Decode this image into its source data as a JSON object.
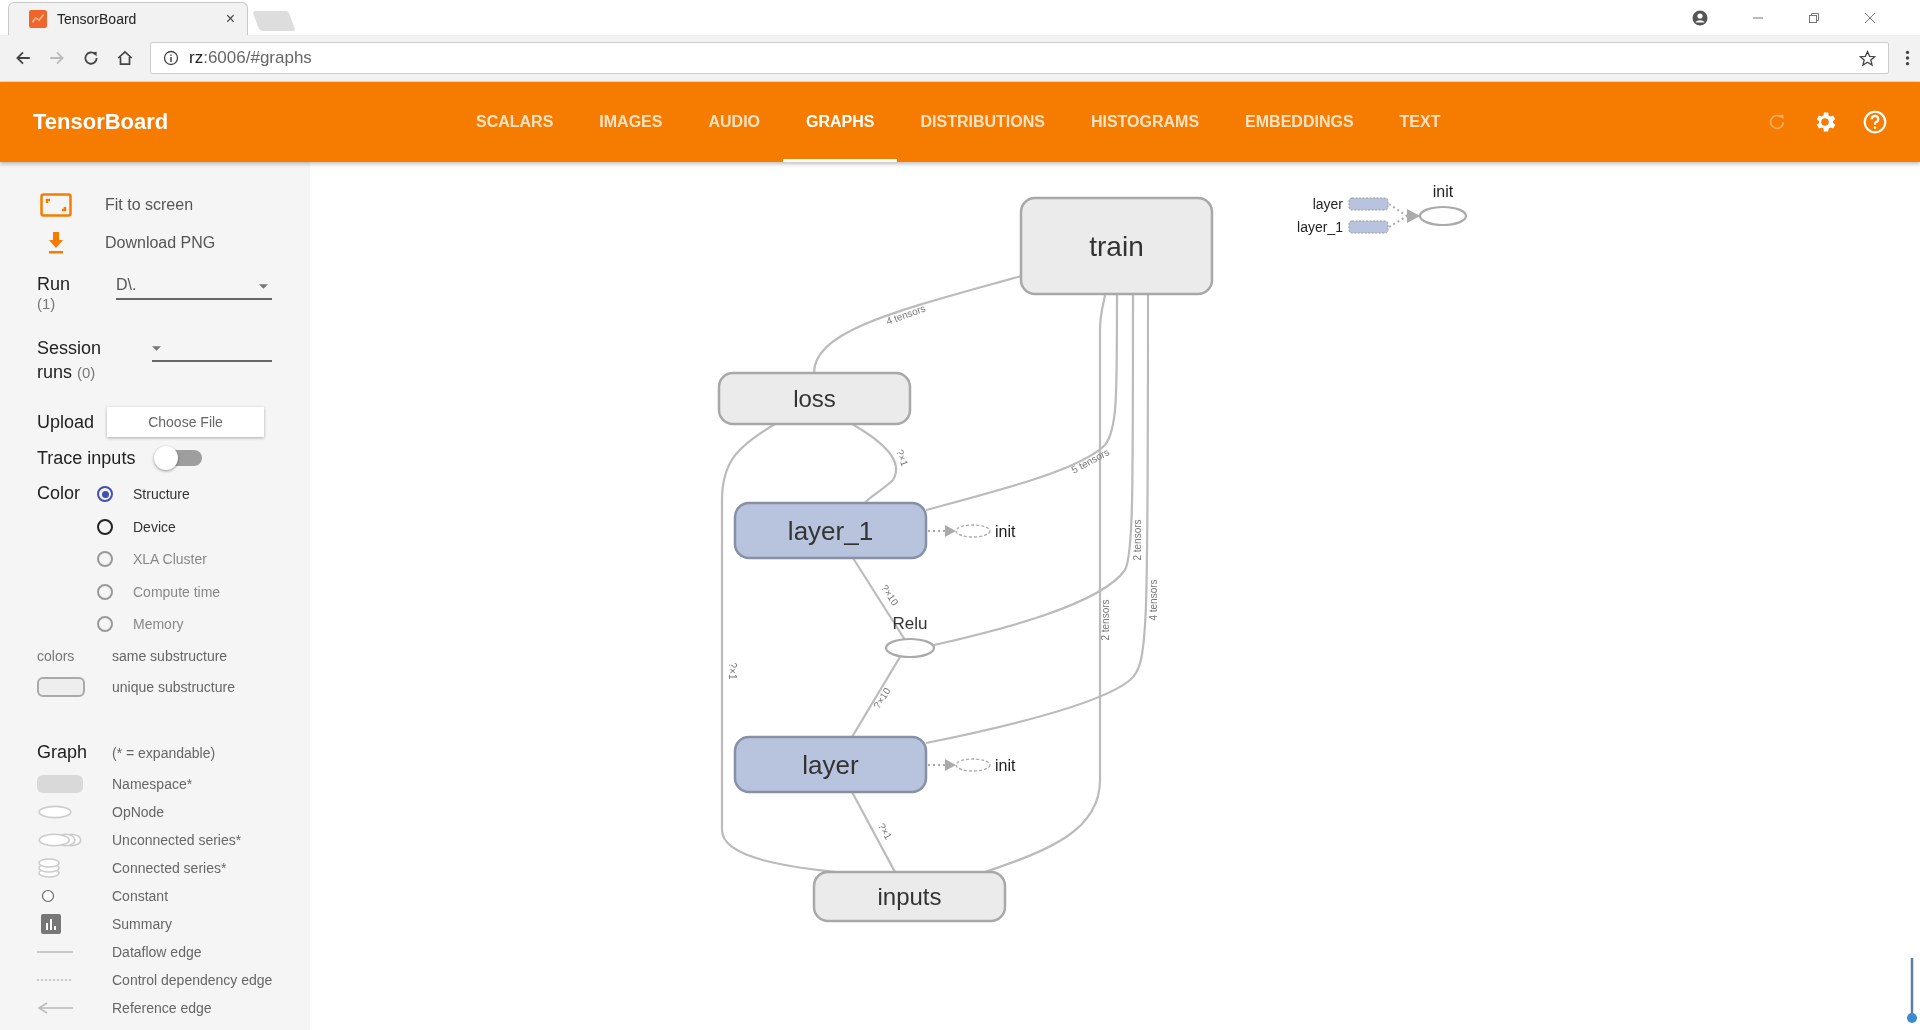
{
  "browser": {
    "tab_title": "TensorBoard",
    "tab_close": "×",
    "url_host": "rz",
    "url_rest": ":6006/#graphs"
  },
  "app": {
    "title": "TensorBoard"
  },
  "nav_tabs": [
    {
      "label": "SCALARS",
      "selected": false
    },
    {
      "label": "IMAGES",
      "selected": false
    },
    {
      "label": "AUDIO",
      "selected": false
    },
    {
      "label": "GRAPHS",
      "selected": true
    },
    {
      "label": "DISTRIBUTIONS",
      "selected": false
    },
    {
      "label": "HISTOGRAMS",
      "selected": false
    },
    {
      "label": "EMBEDDINGS",
      "selected": false
    },
    {
      "label": "TEXT",
      "selected": false
    }
  ],
  "sidebar": {
    "actions": [
      {
        "kind": "fit",
        "label": "Fit to screen"
      },
      {
        "kind": "download",
        "label": "Download PNG"
      }
    ],
    "run": {
      "label": "Run",
      "count": "(1)",
      "value": "D\\."
    },
    "session_runs": {
      "label": "Session runs",
      "count": "(0)"
    },
    "upload": {
      "label": "Upload",
      "button": "Choose File"
    },
    "trace_inputs": {
      "label": "Trace inputs",
      "on": false
    },
    "color": {
      "label": "Color",
      "options": [
        {
          "label": "Structure",
          "selected": true,
          "disabled": false
        },
        {
          "label": "Device",
          "selected": false,
          "disabled": false
        },
        {
          "label": "XLA Cluster",
          "selected": false,
          "disabled": true
        },
        {
          "label": "Compute time",
          "selected": false,
          "disabled": true
        },
        {
          "label": "Memory",
          "selected": false,
          "disabled": true
        }
      ]
    },
    "color_legend": [
      {
        "kind": "text",
        "key": "colors",
        "label": "same substructure"
      },
      {
        "kind": "unique",
        "label": "unique substructure"
      }
    ],
    "graph_legend": {
      "label": "Graph",
      "note": "(* = expandable)",
      "items": [
        {
          "kind": "namespace",
          "label": "Namespace*"
        },
        {
          "kind": "opnode",
          "label": "OpNode"
        },
        {
          "kind": "unconnected",
          "label": "Unconnected series*"
        },
        {
          "kind": "connected",
          "label": "Connected series*"
        },
        {
          "kind": "constant",
          "label": "Constant"
        },
        {
          "kind": "summary",
          "label": "Summary"
        },
        {
          "kind": "dataflow",
          "label": "Dataflow edge"
        },
        {
          "kind": "control",
          "label": "Control dependency edge"
        },
        {
          "kind": "reference",
          "label": "Reference edge"
        }
      ]
    }
  },
  "graph": {
    "namespaces": [
      {
        "label": "train",
        "color": "#ebebeb"
      },
      {
        "label": "loss",
        "color": "#ebebeb"
      },
      {
        "label": "layer_1",
        "color": "#b8c3dd"
      },
      {
        "label": "layer",
        "color": "#b8c3dd"
      },
      {
        "label": "inputs",
        "color": "#ebebeb"
      }
    ],
    "op_nodes": [
      {
        "label": "Relu"
      }
    ],
    "side_inits": [
      "init",
      "init"
    ],
    "edge_labels": [
      "4 tensors",
      "?×1",
      "?×1",
      "5 tensors",
      "?×10",
      "2 tensors",
      "?×10",
      "4 tensors",
      "?×1",
      "2 tensors"
    ],
    "aux": {
      "node": "init",
      "inputs": [
        "layer",
        "layer_1"
      ]
    }
  }
}
